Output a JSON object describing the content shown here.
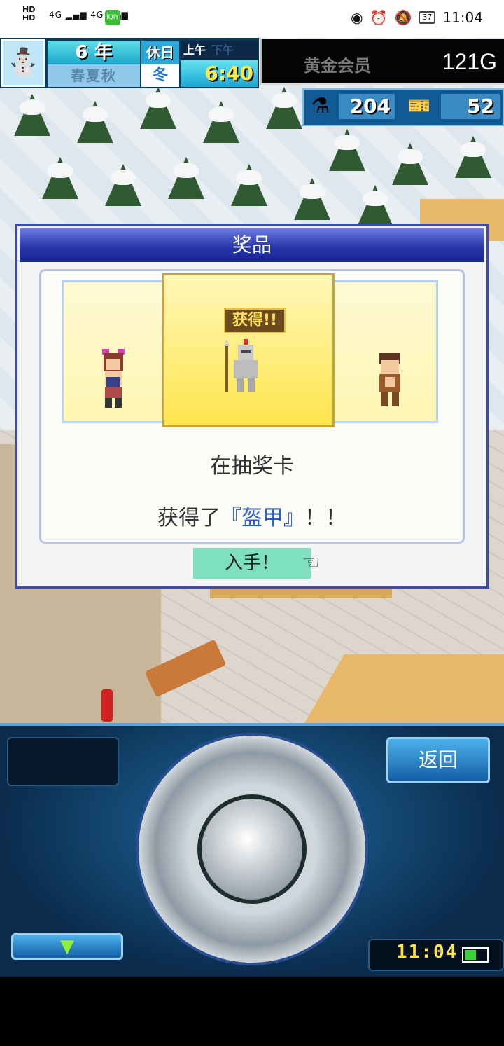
{
  "status_bar": {
    "network_left": "HD",
    "signal": "4G",
    "time": "11:04",
    "battery": "37"
  },
  "hud": {
    "year": "6 年",
    "seasons": "春夏秋",
    "holiday": "休日",
    "season_current": "冬",
    "am": "上午",
    "pm": "下午",
    "time": "6:40",
    "member": "黄金会员",
    "gold": "121G",
    "research_points": "204",
    "tickets": "52"
  },
  "dialog": {
    "title": "奖品",
    "got_badge": "获得!!",
    "message_line1": "在抽奖卡",
    "message_prefix": "获得了",
    "item_name": "『盔甲』",
    "message_suffix": "！！",
    "obtain_button": "入手！"
  },
  "controls": {
    "back_button": "返回",
    "down_arrow": "▼",
    "clock": "11:04"
  },
  "colors": {
    "dialog_title_bg": "#2432a8",
    "obtain_bg": "#7fe0c0",
    "item_text": "#2a5dd0",
    "clock_text": "#ffe14a"
  }
}
